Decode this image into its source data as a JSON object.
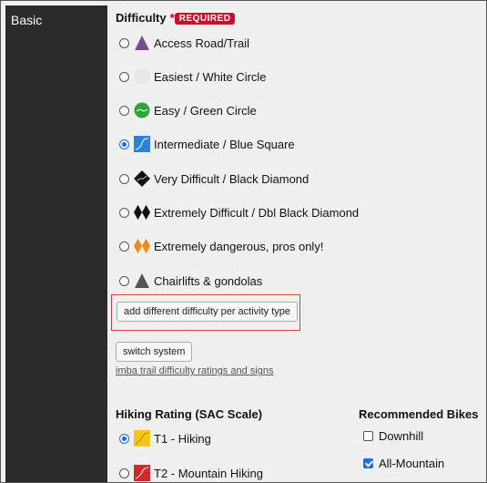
{
  "sidebar": {
    "label": "Basic"
  },
  "difficulty": {
    "title": "Difficulty",
    "required_star": "*",
    "required_badge": "REQUIRED",
    "options": [
      {
        "label": "Access Road/Trail",
        "icon": "purple-triangle-icon",
        "checked": false
      },
      {
        "label": "Easiest / White Circle",
        "icon": "white-circle-icon",
        "checked": false
      },
      {
        "label": "Easy / Green Circle",
        "icon": "green-circle-icon",
        "checked": false
      },
      {
        "label": "Intermediate / Blue Square",
        "icon": "blue-square-icon",
        "checked": true
      },
      {
        "label": "Very Difficult / Black Diamond",
        "icon": "black-diamond-icon",
        "checked": false
      },
      {
        "label": "Extremely Difficult / Dbl Black Diamond",
        "icon": "double-black-diamond-icon",
        "checked": false
      },
      {
        "label": "Extremely dangerous, pros only!",
        "icon": "orange-double-diamond-icon",
        "checked": false
      },
      {
        "label": "Chairlifts & gondolas",
        "icon": "gray-triangle-icon",
        "checked": false
      }
    ],
    "add_per_activity_label": "add different difficulty per activity type",
    "switch_system_label": "switch system",
    "ratings_link": "imba trail difficulty ratings and signs"
  },
  "hiking": {
    "title": "Hiking Rating (SAC Scale)",
    "options": [
      {
        "label": "T1 - Hiking",
        "icon": "yellow-square-icon",
        "checked": true
      },
      {
        "label": "T2 - Mountain Hiking",
        "icon": "red-square-icon",
        "checked": false
      }
    ]
  },
  "bikes": {
    "title": "Recommended Bikes",
    "options": [
      {
        "label": "Downhill",
        "checked": false
      },
      {
        "label": "All-Mountain",
        "checked": true
      }
    ]
  },
  "colors": {
    "sidebar_bg": "#2b2b2b",
    "required_badge": "#c8102e",
    "highlight_border": "#e03a3a",
    "radio_checked": "#1a6ee8"
  }
}
